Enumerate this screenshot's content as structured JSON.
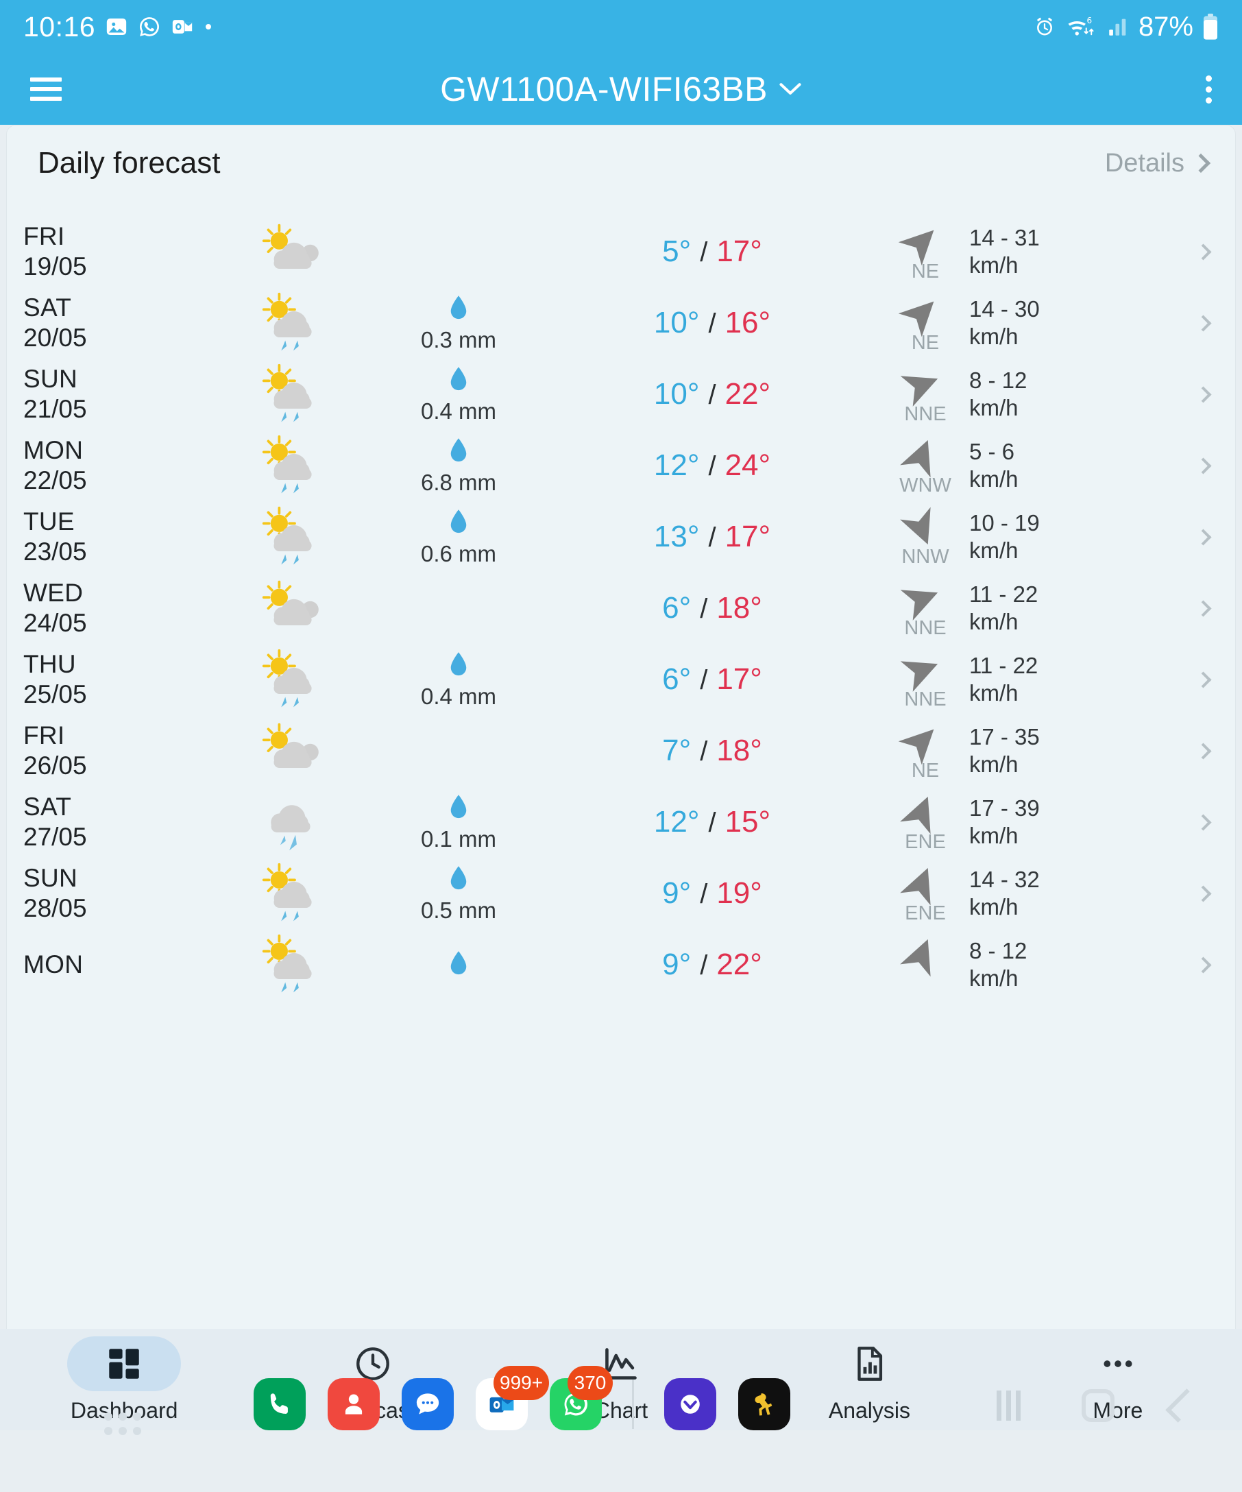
{
  "status_bar": {
    "time": "10:16",
    "battery_percent": "87%",
    "left_icons": [
      "gallery-icon",
      "whatsapp-icon",
      "outlook-icon",
      "dot-icon"
    ],
    "right_icons": [
      "alarm-icon",
      "wifi6-icon",
      "signal-icon",
      "battery-icon"
    ]
  },
  "app_bar": {
    "title": "GW1100A-WIFI63BB",
    "menu_icon": "hamburger-icon",
    "dropdown_icon": "chevron-down-icon",
    "overflow_icon": "kebab-menu-icon",
    "background_color": "#38b3e5"
  },
  "card": {
    "title": "Daily forecast",
    "details_label": "Details",
    "details_icon": "chevron-right-icon"
  },
  "colors": {
    "accent": "#38b3e5",
    "low_temp": "#35a9dc",
    "high_temp": "#e0314f",
    "rain": "#4aaede",
    "muted": "#9aa5aa"
  },
  "units": {
    "rain": "mm",
    "wind": "km/h",
    "temp_sep": "/"
  },
  "forecast": [
    {
      "dow": "FRI",
      "date": "19/05",
      "icon": "partly-cloudy-icon",
      "rain": "",
      "low": "5°",
      "high": "17°",
      "wind": "14 - 31",
      "wind_unit": "km/h",
      "dir": "NE",
      "dir_deg": 45
    },
    {
      "dow": "SAT",
      "date": "20/05",
      "icon": "sun-cloud-rain-icon",
      "rain": "0.3 mm",
      "low": "10°",
      "high": "16°",
      "wind": "14 - 30",
      "wind_unit": "km/h",
      "dir": "NE",
      "dir_deg": 45
    },
    {
      "dow": "SUN",
      "date": "21/05",
      "icon": "sun-cloud-rain-icon",
      "rain": "0.4 mm",
      "low": "10°",
      "high": "22°",
      "wind": "8 - 12",
      "wind_unit": "km/h",
      "dir": "NNE",
      "dir_deg": 68
    },
    {
      "dow": "MON",
      "date": "22/05",
      "icon": "sun-cloud-rain-icon",
      "rain": "6.8 mm",
      "low": "12°",
      "high": "24°",
      "wind": "5 - 6",
      "wind_unit": "km/h",
      "dir": "WNW",
      "dir_deg": 22
    },
    {
      "dow": "TUE",
      "date": "23/05",
      "icon": "sun-cloud-rain-icon",
      "rain": "0.6 mm",
      "low": "13°",
      "high": "17°",
      "wind": "10 - 19",
      "wind_unit": "km/h",
      "dir": "NNW",
      "dir_deg": 158
    },
    {
      "dow": "WED",
      "date": "24/05",
      "icon": "partly-cloudy-icon",
      "rain": "",
      "low": "6°",
      "high": "18°",
      "wind": "11 - 22",
      "wind_unit": "km/h",
      "dir": "NNE",
      "dir_deg": 68
    },
    {
      "dow": "THU",
      "date": "25/05",
      "icon": "sun-cloud-rain-icon",
      "rain": "0.4 mm",
      "low": "6°",
      "high": "17°",
      "wind": "11 - 22",
      "wind_unit": "km/h",
      "dir": "NNE",
      "dir_deg": 68
    },
    {
      "dow": "FRI",
      "date": "26/05",
      "icon": "partly-cloudy-icon",
      "rain": "",
      "low": "7°",
      "high": "18°",
      "wind": "17 - 35",
      "wind_unit": "km/h",
      "dir": "NE",
      "dir_deg": 45
    },
    {
      "dow": "SAT",
      "date": "27/05",
      "icon": "cloud-rain-icon",
      "rain": "0.1 mm",
      "low": "12°",
      "high": "15°",
      "wind": "17 - 39",
      "wind_unit": "km/h",
      "dir": "ENE",
      "dir_deg": 22
    },
    {
      "dow": "SUN",
      "date": "28/05",
      "icon": "sun-cloud-rain-icon",
      "rain": "0.5 mm",
      "low": "9°",
      "high": "19°",
      "wind": "14 - 32",
      "wind_unit": "km/h",
      "dir": "ENE",
      "dir_deg": 22
    },
    {
      "dow": "MON",
      "date": "",
      "icon": "sun-cloud-rain-icon",
      "rain": "",
      "low": "9°",
      "high": "22°",
      "wind": "8 - 12",
      "wind_unit": "km/h",
      "dir": "",
      "dir_deg": 22
    }
  ],
  "bottom_nav": [
    {
      "label": "Dashboard",
      "icon": "dashboard-icon",
      "active": true
    },
    {
      "label": "Forecast",
      "icon": "clock-icon",
      "active": false
    },
    {
      "label": "Chart",
      "icon": "line-chart-icon",
      "active": false
    },
    {
      "label": "Analysis",
      "icon": "document-chart-icon",
      "active": false
    },
    {
      "label": "More",
      "icon": "more-dots-icon",
      "active": false
    }
  ],
  "dock": {
    "apps": [
      {
        "name": "phone-icon",
        "color": "#00a05a",
        "badge": ""
      },
      {
        "name": "contacts-icon",
        "color": "#f0483e",
        "badge": ""
      },
      {
        "name": "messages-icon",
        "color": "#1a73e8",
        "badge": ""
      },
      {
        "name": "outlook-icon",
        "color": "#ffffff",
        "badge": "999+"
      },
      {
        "name": "whatsapp-icon",
        "color": "#25d366",
        "badge": "370"
      },
      {
        "name": "yahoo-icon",
        "color": "#4a30c8",
        "badge": ""
      },
      {
        "name": "bitmoji-icon",
        "color": "#101010",
        "badge": ""
      }
    ],
    "system": [
      "recents-icon",
      "home-icon",
      "back-icon"
    ]
  }
}
